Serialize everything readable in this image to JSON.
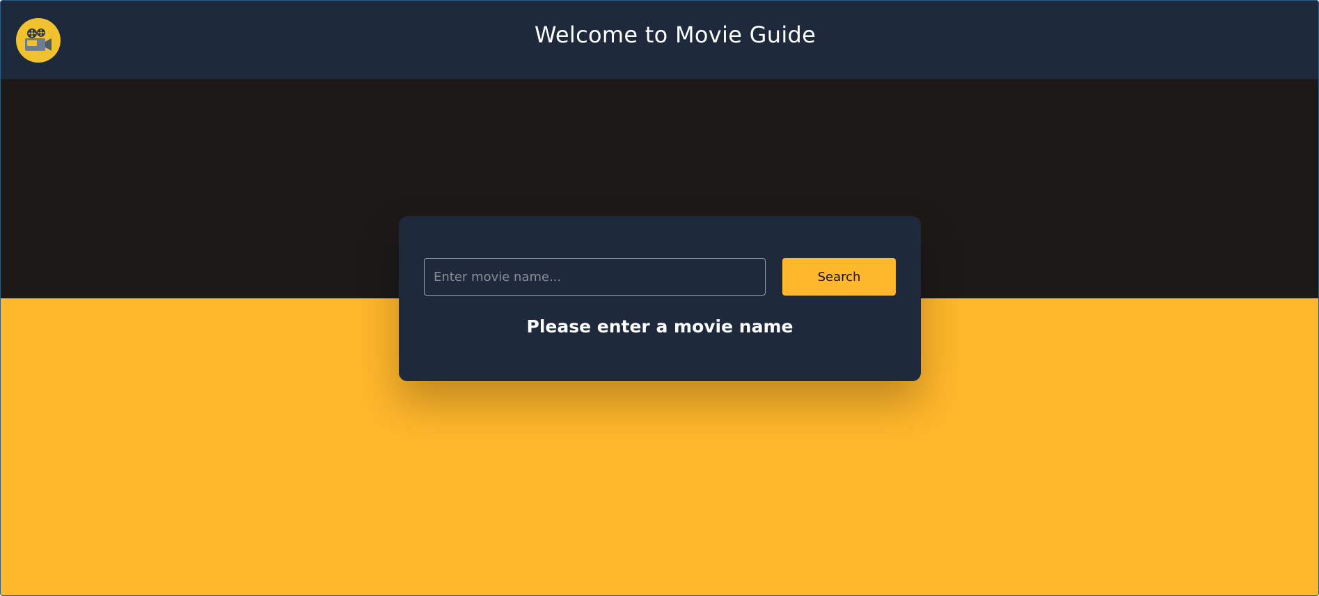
{
  "header": {
    "title": "Welcome to Movie Guide",
    "logo_icon": "movie-camera-icon"
  },
  "search": {
    "placeholder": "Enter movie name...",
    "value": "",
    "button_label": "Search"
  },
  "status": {
    "message": "Please enter a movie name"
  },
  "colors": {
    "header_bg": "#1e293b",
    "dark_band": "#1c1917",
    "accent": "#ffb72b",
    "card_bg": "#1e293b"
  }
}
